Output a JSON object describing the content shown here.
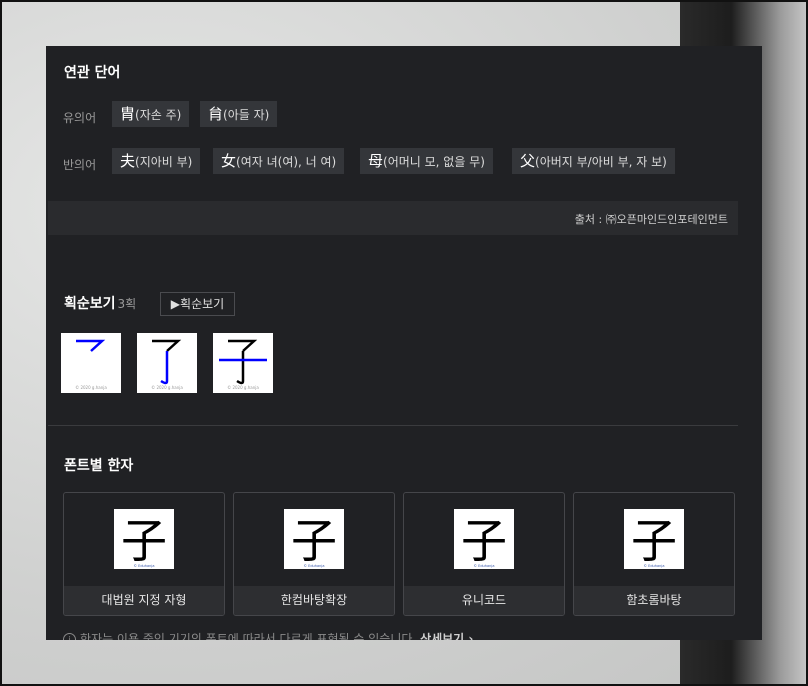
{
  "related": {
    "title": "연관 단어",
    "synonym_label": "유의어",
    "synonyms": [
      {
        "han": "胄",
        "meaning": "(자손 주)"
      },
      {
        "han": "䏍",
        "meaning": "(아들 자)"
      }
    ],
    "antonym_label": "반의어",
    "antonyms": [
      {
        "han": "夫",
        "meaning": "(지아비 부)"
      },
      {
        "han": "女",
        "meaning": "(여자 녀(여), 너 여)"
      },
      {
        "han": "母",
        "meaning": "(어머니 모, 없을 무)"
      },
      {
        "han": "父",
        "meaning": "(아버지 부/아비 부, 자 보)"
      }
    ],
    "source": "출처 : ㈜오픈마인드인포테인먼트"
  },
  "stroke": {
    "title": "획순보기",
    "count": "3획",
    "button_label": "▶획순보기",
    "watermark": "© 2020 g.hanja"
  },
  "fonts": {
    "title": "폰트별 한자",
    "character": "子",
    "cards": [
      {
        "label": "대법원 지정 자형"
      },
      {
        "label": "한컴바탕확장"
      },
      {
        "label": "유니코드"
      },
      {
        "label": "함초롬바탕"
      }
    ],
    "note": "한자는 이용 중인 기기의 폰트에 따라서 다르게 표현될 수 있습니다.",
    "more_link": "상세보기 ›",
    "watermark": "© Eduhanja"
  },
  "colors": {
    "panel_bg": "#202124",
    "chip_bg": "#34363a",
    "stroke_highlight": "#0000ff"
  }
}
